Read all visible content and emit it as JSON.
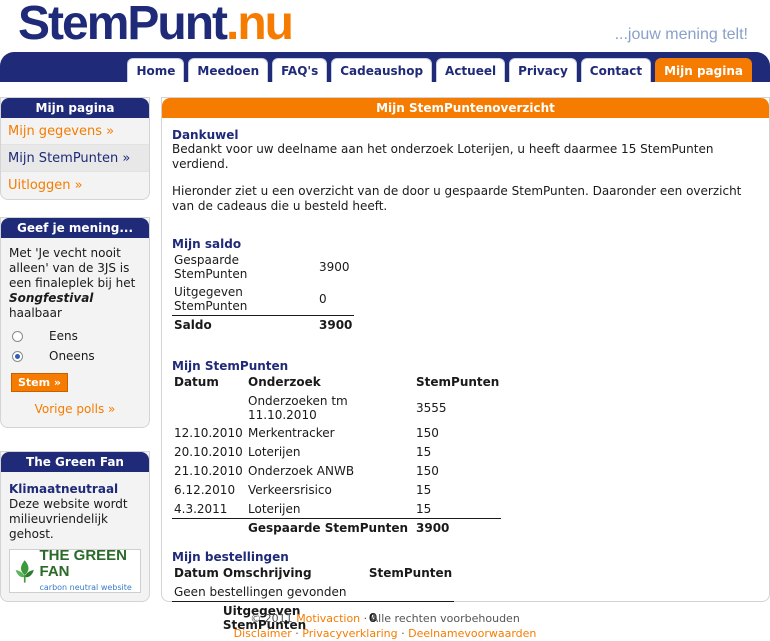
{
  "header": {
    "logo_part1": "StemPunt",
    "logo_part2": ".nu",
    "tagline": "...jouw mening telt!"
  },
  "nav": {
    "tabs": [
      "Home",
      "Meedoen",
      "FAQ's",
      "Cadeaushop",
      "Actueel",
      "Privacy",
      "Contact",
      "Mijn pagina"
    ],
    "active": "Mijn pagina"
  },
  "sidebar": {
    "mijn_pagina": {
      "title": "Mijn pagina",
      "items": [
        "Mijn gegevens »",
        "Mijn StemPunten »",
        "Uitloggen »"
      ]
    },
    "poll": {
      "title": "Geef je mening...",
      "question_pre": "Met 'Je vecht nooit alleen' van de 3JS is een finaleplek bij het ",
      "question_em": "Songfestival",
      "question_post": " haalbaar",
      "options": [
        "Eens",
        "Oneens"
      ],
      "selected": "Oneens",
      "submit": "Stem »",
      "previous": "Vorige polls »"
    },
    "green_fan": {
      "title": "The Green Fan",
      "subtitle": "Klimaatneutraal",
      "text": "Deze website wordt milieuvriendelijk gehost.",
      "logo_line1": "THE GREEN FAN",
      "logo_line2": "carbon neutral website"
    }
  },
  "main": {
    "title": "Mijn StemPuntenoverzicht",
    "thanks_heading": "Dankuwel",
    "thanks_text": "Bedankt voor uw deelname aan het onderzoek Loterijen, u heeft daarmee 15 StemPunten verdiend.",
    "intro_text": "Hieronder ziet u een overzicht van de door u gespaarde StemPunten. Daaronder een overzicht van de cadeaus die u besteld heeft.",
    "saldo": {
      "heading": "Mijn saldo",
      "rows": [
        {
          "label": "Gespaarde StemPunten",
          "value": "3900"
        },
        {
          "label": "Uitgegeven StemPunten",
          "value": "0"
        }
      ],
      "total_label": "Saldo",
      "total_value": "3900"
    },
    "stempunten": {
      "heading": "Mijn StemPunten",
      "columns": [
        "Datum",
        "Onderzoek",
        "StemPunten"
      ],
      "rows": [
        {
          "datum": "",
          "onderzoek": "Onderzoeken tm 11.10.2010",
          "punten": "3555"
        },
        {
          "datum": "12.10.2010",
          "onderzoek": "Merkentracker",
          "punten": "150"
        },
        {
          "datum": "20.10.2010",
          "onderzoek": "Loterijen",
          "punten": "15"
        },
        {
          "datum": "21.10.2010",
          "onderzoek": "Onderzoek ANWB",
          "punten": "150"
        },
        {
          "datum": "6.12.2010",
          "onderzoek": "Verkeersrisico",
          "punten": "15"
        },
        {
          "datum": "4.3.2011",
          "onderzoek": "Loterijen",
          "punten": "15"
        }
      ],
      "total_label": "Gespaarde StemPunten",
      "total_value": "3900"
    },
    "bestellingen": {
      "heading": "Mijn bestellingen",
      "columns": [
        "Datum",
        "Omschrijving",
        "StemPunten"
      ],
      "empty": "Geen bestellingen gevonden",
      "total_label": "Uitgegeven StemPunten",
      "total_value": "0"
    }
  },
  "footer": {
    "copyright_pre": "© 2011 ",
    "company": "Motivaction",
    "copyright_post": " · Alle rechten voorbehouden",
    "links": [
      "Disclaimer",
      "Privacyverklaring",
      "Deelnamevoorwaarden"
    ],
    "sep": " · "
  }
}
